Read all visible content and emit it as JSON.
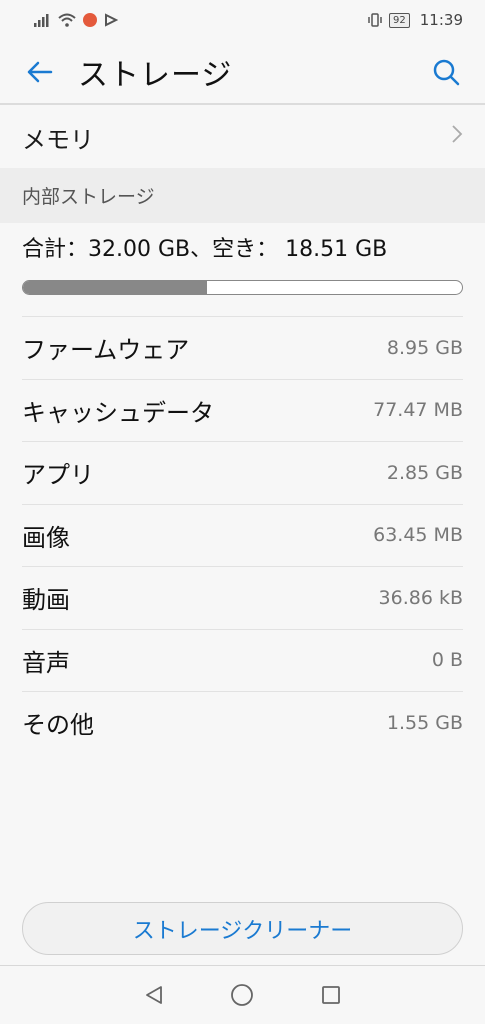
{
  "status": {
    "battery": "92",
    "time": "11:39"
  },
  "header": {
    "title": "ストレージ"
  },
  "memory": {
    "label": "メモリ"
  },
  "section": {
    "title": "内部ストレージ"
  },
  "summary": {
    "text": "合計：32.00 GB、空き： 18.51 GB",
    "used_fraction": 0.42
  },
  "items": [
    {
      "label": "ファームウェア",
      "value": "8.95 GB"
    },
    {
      "label": "キャッシュデータ",
      "value": "77.47 MB"
    },
    {
      "label": "アプリ",
      "value": "2.85 GB"
    },
    {
      "label": "画像",
      "value": "63.45 MB"
    },
    {
      "label": "動画",
      "value": "36.86 kB"
    },
    {
      "label": "音声",
      "value": "0 B"
    },
    {
      "label": "その他",
      "value": "1.55 GB"
    }
  ],
  "cleaner": {
    "label": "ストレージクリーナー"
  },
  "colors": {
    "accent": "#1a7ad1",
    "bar_fill": "#888888"
  }
}
